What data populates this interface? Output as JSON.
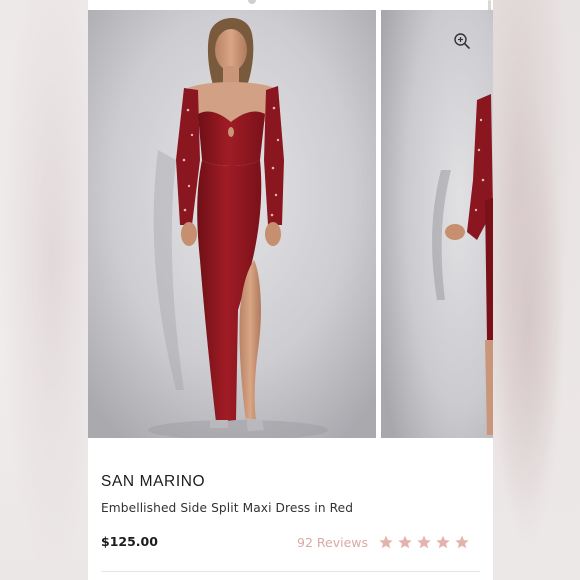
{
  "product": {
    "brand": "SAN MARINO",
    "name": "Embellished Side Split Maxi Dress in Red",
    "price": "$125.00",
    "reviews_label": "92 Reviews",
    "rating": 5,
    "rating_max": 5
  },
  "icons": {
    "zoom": "magnifier-plus-icon",
    "star": "star-icon"
  },
  "colors": {
    "dress": "#8e1820",
    "star": "#e3b3ae",
    "reviews_text": "#d9a9a4"
  }
}
